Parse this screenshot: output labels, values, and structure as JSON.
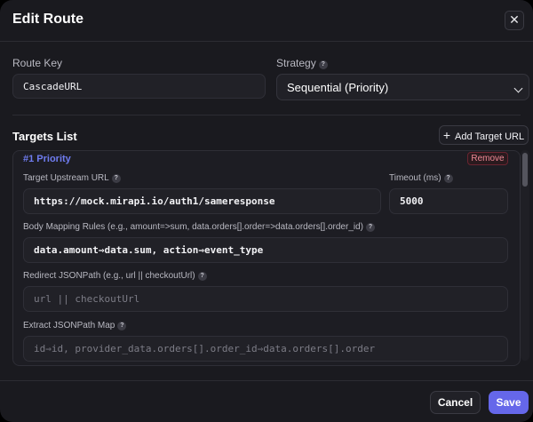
{
  "header": {
    "title": "Edit Route",
    "close_label": "✕"
  },
  "route_key": {
    "label": "Route Key",
    "value": "CascadeURL"
  },
  "strategy": {
    "label": "Strategy",
    "selected": "Sequential (Priority)"
  },
  "targets": {
    "title": "Targets List",
    "add_label": "Add Target URL",
    "add_icon": "+",
    "card": {
      "priority": "#1 Priority",
      "remove_label": "Remove",
      "upstream_label": "Target Upstream URL",
      "upstream_value": "https://mock.mirapi.io/auth1/sameresponse",
      "timeout_label": "Timeout (ms)",
      "timeout_value": "5000",
      "body_mapping_label": "Body Mapping Rules (e.g., amount=>sum, data.orders[].order=>data.orders[].order_id)",
      "body_mapping_value": "data.amount⇒data.sum, action⇒event_type",
      "redirect_label": "Redirect JSONPath (e.g., url || checkoutUrl)",
      "redirect_placeholder": "url || checkoutUrl",
      "extract_label": "Extract JSONPath Map",
      "extract_placeholder": "id⇒id, provider_data.orders[].order_id⇒data.orders[].order"
    }
  },
  "footer": {
    "cancel_label": "Cancel",
    "save_label": "Save"
  },
  "colors": {
    "accent": "#6567ea",
    "priority": "#6f7cf0",
    "remove": "#f08a96",
    "background": "#1a1a1f"
  },
  "help_icon": "?"
}
